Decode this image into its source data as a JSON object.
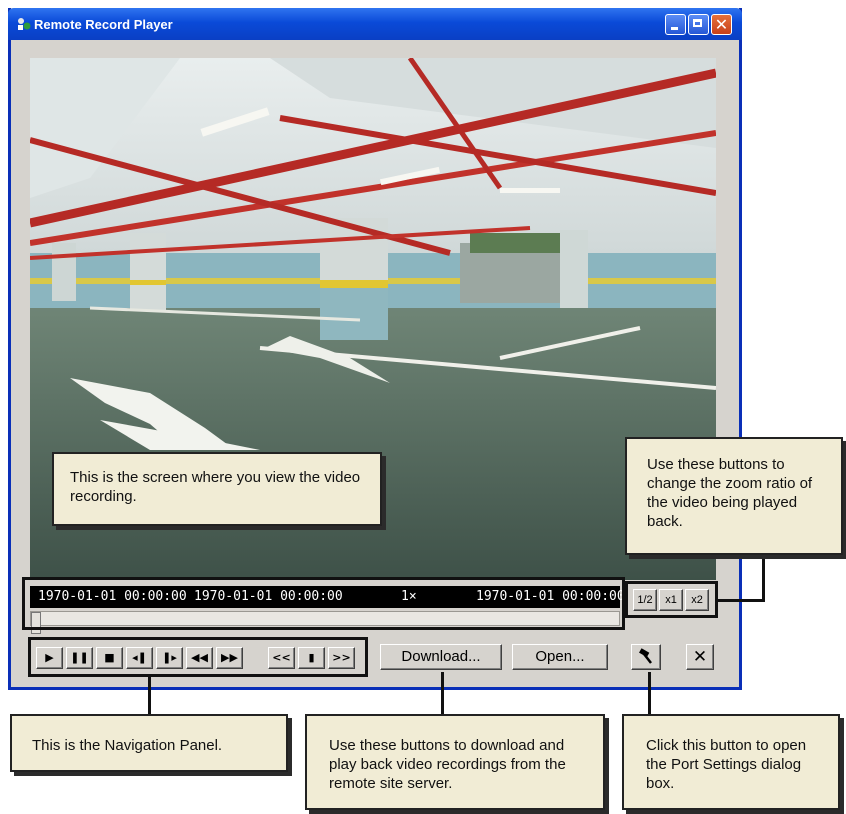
{
  "window": {
    "title": "Remote Record Player"
  },
  "status_bar": {
    "start_time": "1970-01-01 00:00:00",
    "current_time": "1970-01-01 00:00:00",
    "speed": "1×",
    "end_time": "1970-01-01 00:00:00"
  },
  "zoom_buttons": [
    "1/2",
    "x1",
    "x2"
  ],
  "nav_buttons": [
    {
      "icon": "play-icon",
      "glyph": "▶"
    },
    {
      "icon": "pause-icon",
      "glyph": "❚❚"
    },
    {
      "icon": "stop-icon",
      "glyph": "■"
    },
    {
      "icon": "step-back-icon",
      "glyph": "◂❚"
    },
    {
      "icon": "step-forward-icon",
      "glyph": "❚▸"
    },
    {
      "icon": "rewind-icon",
      "glyph": "◀◀"
    },
    {
      "icon": "fast-forward-icon",
      "glyph": "▶▶"
    }
  ],
  "jump_buttons": [
    {
      "icon": "jump-start-icon",
      "glyph": "<<"
    },
    {
      "icon": "marker-icon",
      "glyph": "▮"
    },
    {
      "icon": "jump-end-icon",
      "glyph": ">>"
    }
  ],
  "actions": {
    "download": "Download...",
    "open": "Open..."
  },
  "callouts": {
    "screen": "This is the screen where you view the video recording.",
    "zoom": "Use these buttons to change the zoom ratio of the video being played back.",
    "navigation": "This is the Navigation Panel.",
    "download": "Use these buttons to download and play back video recordings from the remote site server.",
    "port_settings": "Click this button to open the Port Settings dialog box."
  }
}
